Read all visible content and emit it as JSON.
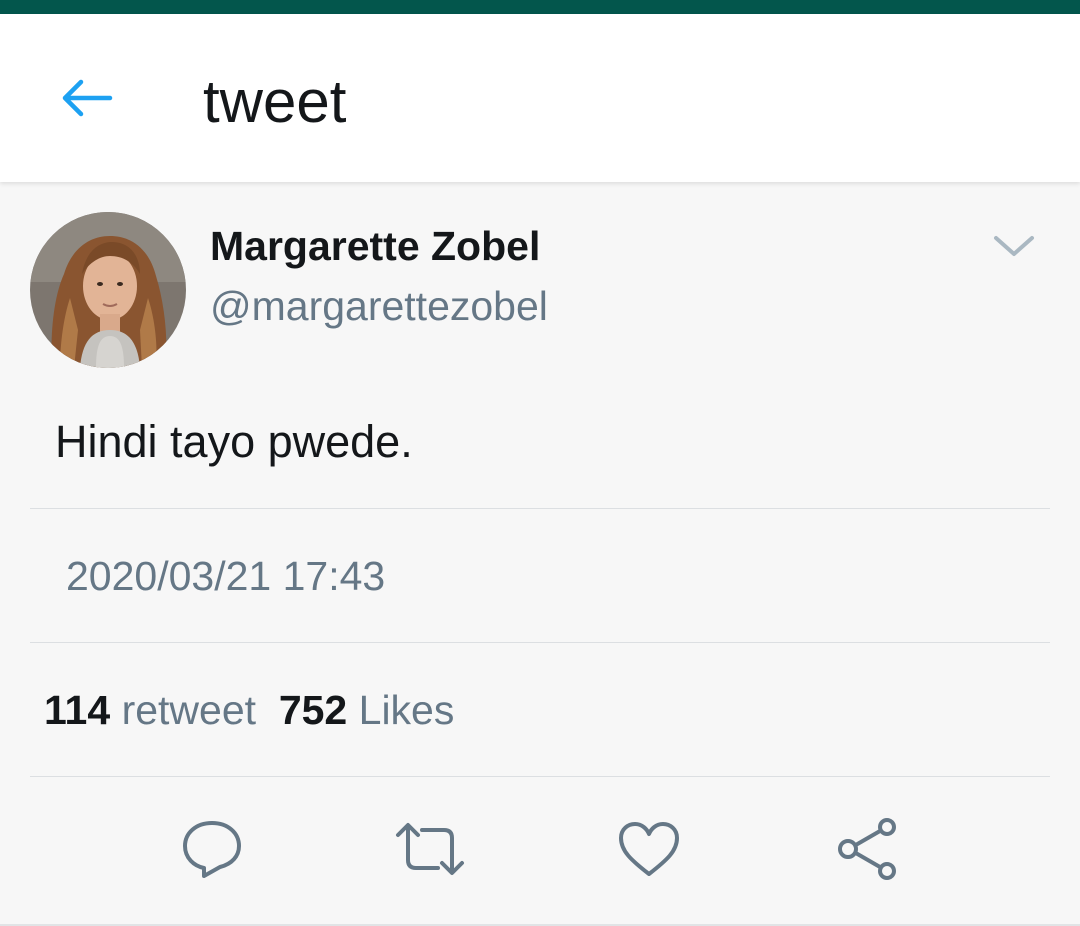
{
  "header": {
    "title": "tweet",
    "back_icon": "arrow-left-icon",
    "accent": "#1da1f2",
    "status_bar_color": "#03564c"
  },
  "tweet": {
    "display_name": "Margarette Zobel",
    "handle": "@margarettezobel",
    "text": "Hindi tayo pwede.",
    "timestamp": "2020/03/21 17:43",
    "stats": {
      "retweet_count": "114",
      "retweet_label": "retweet",
      "likes_count": "752",
      "likes_label": "Likes"
    },
    "more_icon": "chevron-down-icon"
  },
  "actions": [
    {
      "icon": "reply-icon"
    },
    {
      "icon": "retweet-icon"
    },
    {
      "icon": "heart-icon"
    },
    {
      "icon": "share-icon"
    }
  ]
}
